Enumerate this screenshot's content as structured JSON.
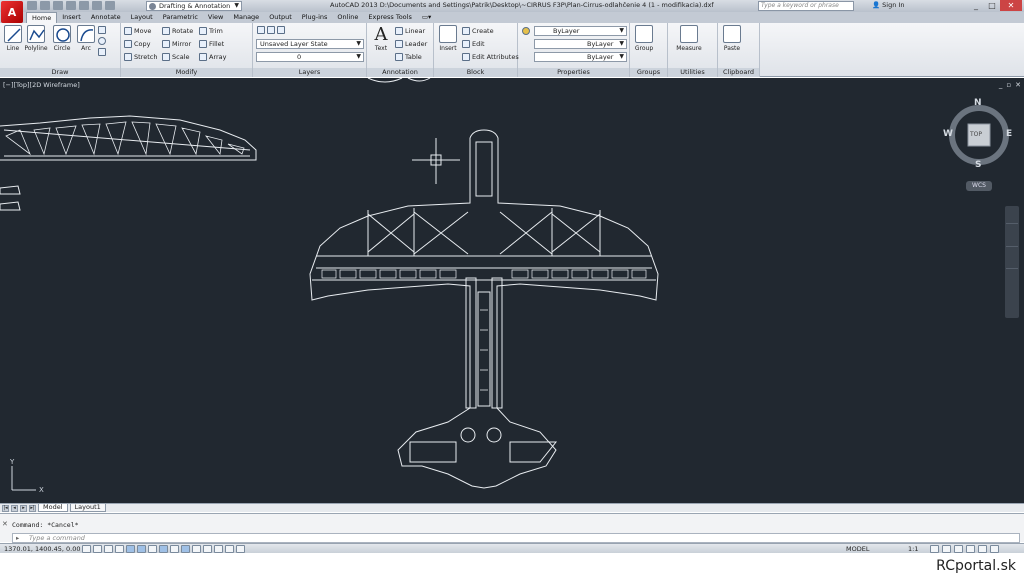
{
  "app": {
    "logo_letter": "A",
    "window_title": "AutoCAD 2013    D:\\Documents and Settings\\Patrik\\Desktop\\~CIRRUS F3P\\Plan-Cirrus-odlahčenie 4 (1 - modifikacia).dxf",
    "workspace": "Drafting & Annotation",
    "search_placeholder": "Type a keyword or phrase",
    "sign_in": "Sign In"
  },
  "ribbon_tabs": [
    "Home",
    "Insert",
    "Annotate",
    "Layout",
    "Parametric",
    "View",
    "Manage",
    "Output",
    "Plug-ins",
    "Online",
    "Express Tools"
  ],
  "ribbon": {
    "draw": {
      "title": "Draw",
      "line": "Line",
      "polyline": "Polyline",
      "circle": "Circle",
      "arc": "Arc"
    },
    "modify": {
      "title": "Modify",
      "move": "Move",
      "rotate": "Rotate",
      "trim": "Trim",
      "copy": "Copy",
      "mirror": "Mirror",
      "fillet": "Fillet",
      "stretch": "Stretch",
      "scale": "Scale",
      "array": "Array"
    },
    "layers": {
      "title": "Layers",
      "layer_state": "Unsaved Layer State",
      "current_layer": "0"
    },
    "annotation": {
      "title": "Annotation",
      "text": "Text",
      "linear": "Linear",
      "leader": "Leader",
      "table": "Table"
    },
    "block": {
      "title": "Block",
      "insert": "Insert",
      "create": "Create",
      "edit": "Edit",
      "edit_attributes": "Edit Attributes"
    },
    "properties": {
      "title": "Properties",
      "color": "ByLayer",
      "linetype": "ByLayer",
      "lineweight": "ByLayer"
    },
    "groups": {
      "title": "Groups",
      "group": "Group"
    },
    "utilities": {
      "title": "Utilities",
      "measure": "Measure"
    },
    "clipboard": {
      "title": "Clipboard",
      "paste": "Paste"
    }
  },
  "viewport": {
    "label": "[−][Top][2D Wireframe]",
    "viewcube": {
      "n": "N",
      "s": "S",
      "e": "E",
      "w": "W",
      "face": "TOP"
    },
    "wcs": "WCS",
    "ucs_x": "X",
    "ucs_y": "Y"
  },
  "layout_tabs": [
    "Model",
    "Layout1"
  ],
  "command": {
    "history": "Command: *Cancel*",
    "placeholder": "Type a command"
  },
  "status": {
    "coords": "1370.01, 1400.45, 0.00",
    "model": "MODEL",
    "scale": "1:1"
  },
  "watermark": "RCportal.sk",
  "colors": {
    "canvas": "#212830",
    "linework": "#e8ecf0",
    "ribbon_bg": "#e6e9ee"
  }
}
